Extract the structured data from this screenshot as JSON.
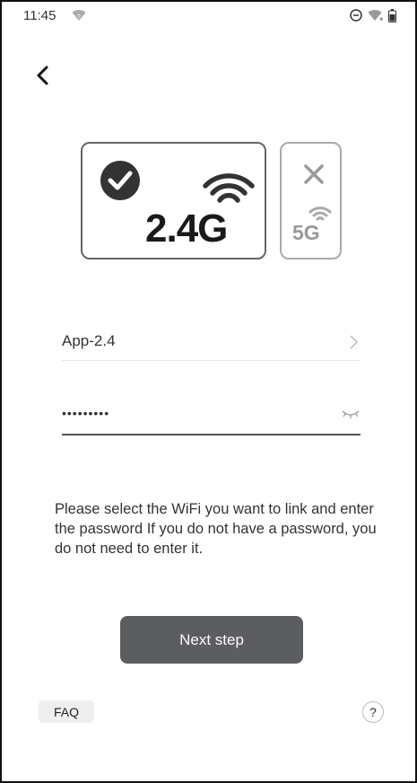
{
  "status_bar": {
    "time": "11:45"
  },
  "bands": {
    "band_24_label": "2.4G",
    "band_24_icon": "check-circle-icon",
    "band_5_label": "5G",
    "band_5_icon": "close-icon"
  },
  "wifi_form": {
    "ssid_value": "App-2.4",
    "password_value": "•••••••••",
    "password_icon": "eye-closed-icon"
  },
  "info_text": "Please select the WiFi you want to link and enter the password If you do not have a password, you do not need to enter it.",
  "next_button_label": "Next step",
  "footer": {
    "faq_label": "FAQ",
    "help_label": "?"
  },
  "colors": {
    "primary_button": "#5b5d60",
    "active_border": "#666666",
    "inactive_border": "#aaaaaa"
  }
}
